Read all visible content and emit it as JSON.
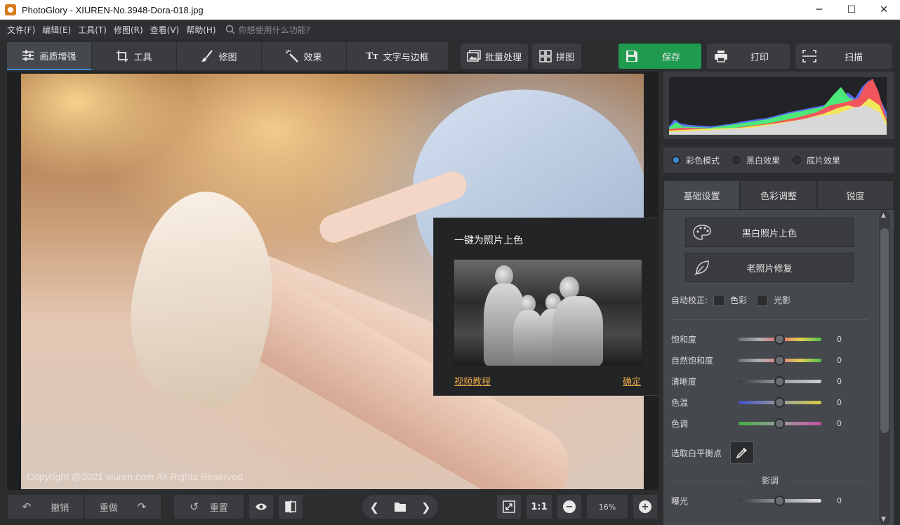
{
  "window": {
    "title": "PhotoGlory - XIUREN-No.3948-Dora-018.jpg",
    "minimize": "─",
    "maximize": "☐",
    "close": "✕"
  },
  "menu": {
    "items": [
      "文件(F)",
      "编辑(E)",
      "工具(T)",
      "修图(R)",
      "查看(V)",
      "帮助(H)"
    ],
    "search_placeholder": "你想使用什么功能?"
  },
  "tabs": [
    {
      "label": "画质增强",
      "icon": "sliders-icon",
      "active": true
    },
    {
      "label": "工具",
      "icon": "crop-icon"
    },
    {
      "label": "修图",
      "icon": "brush-icon"
    },
    {
      "label": "效果",
      "icon": "magic-wand-icon"
    },
    {
      "label": "文字与边框",
      "icon": "text-icon"
    }
  ],
  "toolbar": {
    "batch": "批量处理",
    "collage": "拼图",
    "save": "保存",
    "print": "打印",
    "scan": "扫描"
  },
  "photo": {
    "copyright": "Copyright @2021  xiuren.com  All Rights Reserved"
  },
  "popup": {
    "title": "一键为照片上色",
    "video_link": "视频教程",
    "ok": "确定"
  },
  "bottom": {
    "undo": "撤销",
    "redo": "重做",
    "reset": "重置",
    "ratio": "1:1",
    "zoom": "16%"
  },
  "histogram": {
    "colors": {
      "red": "#f0565c",
      "green": "#4de87a",
      "blue": "#5a6df0",
      "yellow": "#f2e65a",
      "magenta": "#e85ae0",
      "cyan": "#54e4e8",
      "gray": "#d8d8d8"
    }
  },
  "modes": [
    {
      "label": "彩色模式",
      "selected": true
    },
    {
      "label": "黑白效果",
      "selected": false
    },
    {
      "label": "底片效果",
      "selected": false
    }
  ],
  "panel_tabs": [
    "基础设置",
    "色彩调整",
    "锐度"
  ],
  "settings": {
    "colorize_bw": "黑白照片上色",
    "restore_old": "老照片修复",
    "auto_correct": "自动校正:",
    "auto_color": "色彩",
    "auto_light": "光影",
    "sliders": [
      {
        "label": "饱和度",
        "value": "0"
      },
      {
        "label": "自然饱和度",
        "value": "0"
      },
      {
        "label": "清晰度",
        "value": "0"
      },
      {
        "label": "色温",
        "value": "0"
      },
      {
        "label": "色调",
        "value": "0"
      }
    ],
    "white_balance": "选取白平衡点",
    "shadows_section": "影调",
    "exposure": {
      "label": "曝光",
      "value": "0"
    }
  }
}
